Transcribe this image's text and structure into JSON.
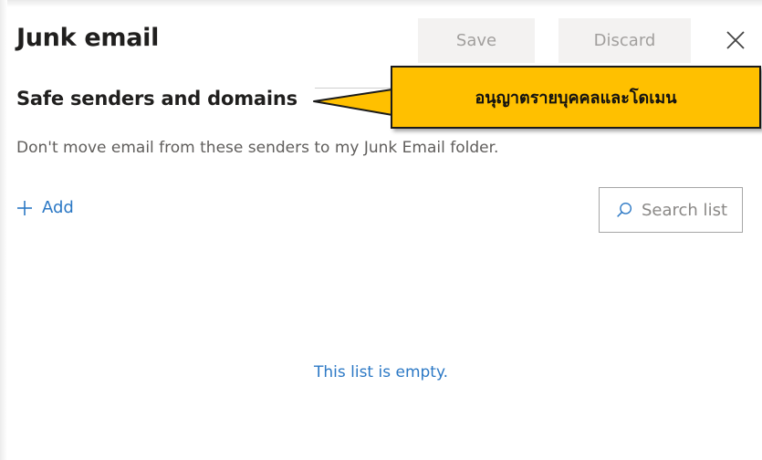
{
  "header": {
    "title": "Junk email",
    "save_label": "Save",
    "discard_label": "Discard",
    "close_icon": "close-icon"
  },
  "section": {
    "title": "Safe senders and domains",
    "description": "Don't move email from these senders to my Junk Email folder."
  },
  "callout": {
    "text": "อนุญาตรายบุคคลและโดเมน",
    "color": "#ffc000"
  },
  "toolbar": {
    "add_label": "Add",
    "add_icon": "plus-icon",
    "search_placeholder": "Search list",
    "search_icon": "search-icon"
  },
  "list": {
    "empty_text": "This list is empty."
  },
  "colors": {
    "accent": "#2b78c5",
    "button_bg": "#f3f2f1",
    "button_text": "#a19f9d"
  }
}
